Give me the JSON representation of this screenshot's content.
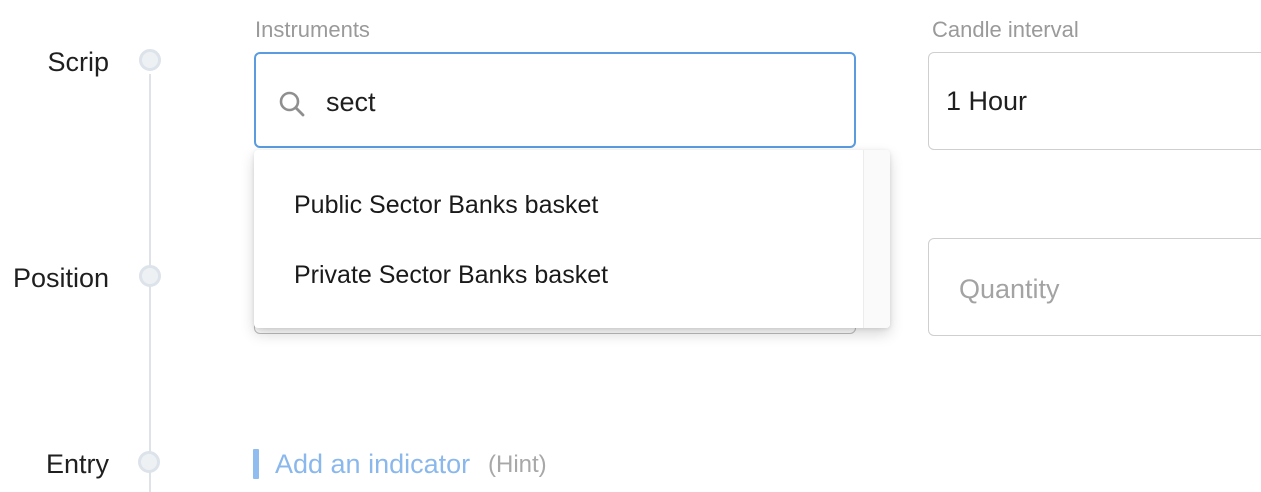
{
  "steps": {
    "scrip": "Scrip",
    "position": "Position",
    "entry": "Entry"
  },
  "instruments": {
    "caption": "Instruments",
    "search_value": "sect",
    "search_icon": "search-icon",
    "suggestions": [
      "Public Sector Banks basket",
      "Private Sector Banks basket"
    ]
  },
  "candle_interval": {
    "caption": "Candle interval",
    "value": "1 Hour"
  },
  "position": {
    "quantity_placeholder": "Quantity"
  },
  "entry": {
    "add_indicator_label": "Add an indicator",
    "hint_label": "(Hint)"
  },
  "colors": {
    "focus_border": "#5b9be0",
    "link_blue": "#8ab8ec",
    "caption_gray": "#9a9a9a"
  }
}
